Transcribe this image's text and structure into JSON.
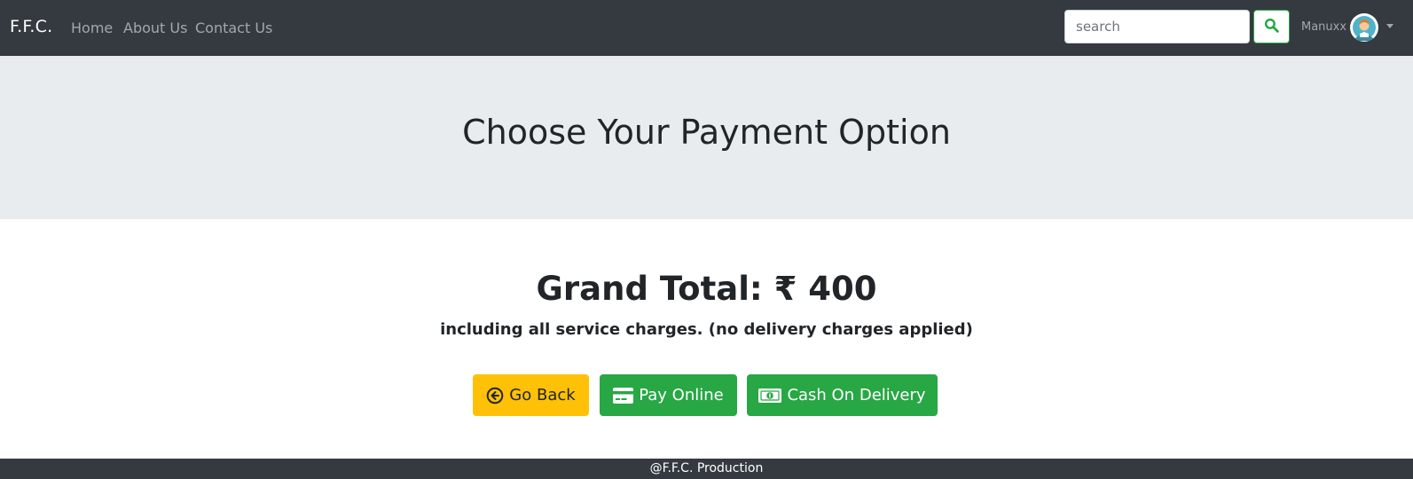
{
  "navbar": {
    "brand": "F.F.C.",
    "links": [
      "Home",
      "About Us",
      "Contact Us"
    ],
    "search": {
      "placeholder": "search",
      "value": ""
    },
    "search_icon": "search-icon",
    "user": {
      "name": "Manuxx",
      "avatar_icon": "user-avatar-icon"
    }
  },
  "jumbotron": {
    "title": "Choose Your Payment Option"
  },
  "main": {
    "grand_total": "Grand Total: ₹ 400",
    "subtext": "including all service charges. (no delivery charges applied)",
    "buttons": {
      "back": {
        "label": "Go Back",
        "icon": "arrow-circle-left-icon",
        "color": "#ffc107"
      },
      "online": {
        "label": "Pay Online",
        "icon": "credit-card-icon",
        "color": "#28a745"
      },
      "cod": {
        "label": "Cash On Delivery",
        "icon": "money-bill-icon",
        "color": "#28a745"
      }
    }
  },
  "footer": {
    "text": "@F.F.C. Production"
  },
  "colors": {
    "navbar": "#343a40",
    "jumbotron": "#e9ecef",
    "success": "#28a745",
    "warning": "#ffc107"
  }
}
